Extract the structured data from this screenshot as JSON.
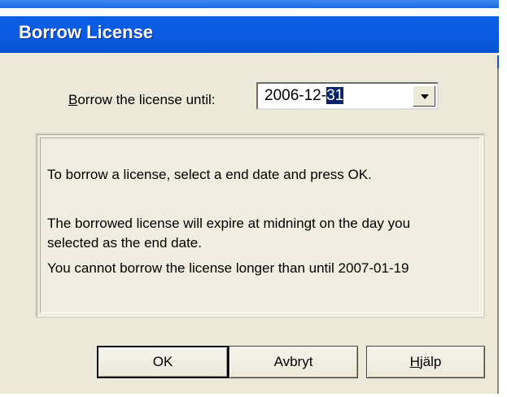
{
  "window": {
    "title": "Borrow License"
  },
  "borrow": {
    "label_prefix": "B",
    "label_rest": "orrow the license until:",
    "date_value_unselected": "2006-12-",
    "date_value_selected": "31"
  },
  "info": {
    "line1": "To borrow a license, select a end date and press OK.",
    "line2": "The borrowed license will expire at midningt on the day you selected as the end date.",
    "line3": "You cannot borrow the license  longer than until 2007-01-19"
  },
  "buttons": {
    "ok": "OK",
    "cancel": "Avbryt",
    "help_prefix": "H",
    "help_rest": "jälp"
  },
  "colors": {
    "titlebar": "#0a5ae2",
    "dialog_bg": "#ece9d8",
    "selection": "#0a246a"
  }
}
